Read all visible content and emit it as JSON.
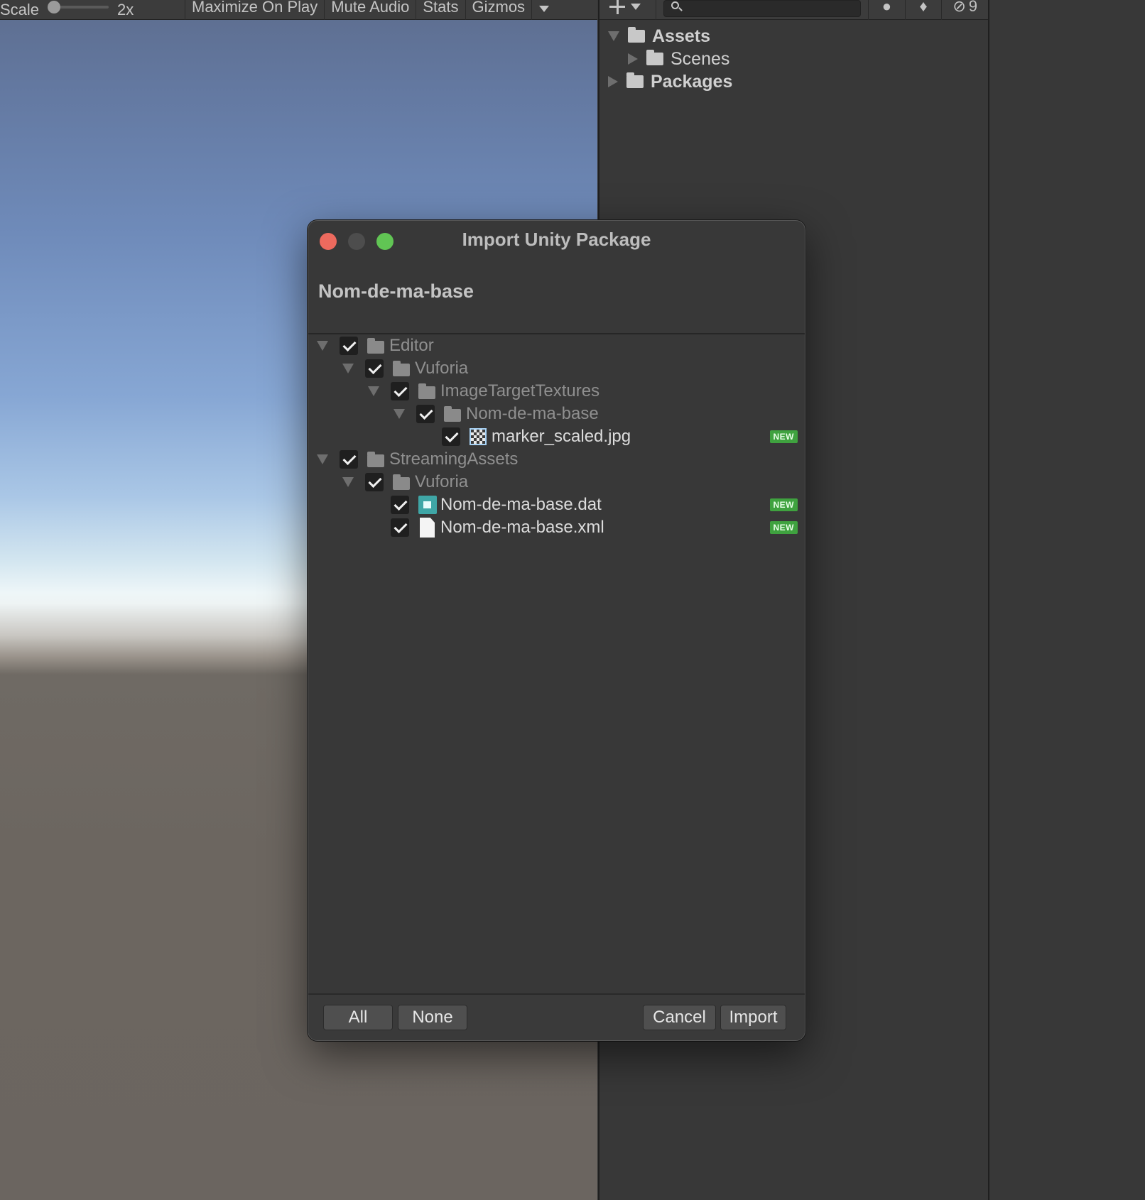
{
  "game_toolbar": {
    "scale_label": "Scale",
    "scale_value": "2x",
    "maximize_label": "Maximize On Play",
    "mute_label": "Mute Audio",
    "stats_label": "Stats",
    "gizmos_label": "Gizmos"
  },
  "project_panel": {
    "hidden_count": "9",
    "tree": [
      {
        "label": "Assets",
        "expanded": true
      },
      {
        "label": "Scenes",
        "expanded": false
      },
      {
        "label": "Packages",
        "expanded": false
      }
    ]
  },
  "dialog": {
    "title": "Import Unity Package",
    "package_name": "Nom-de-ma-base",
    "items": [
      {
        "label": "Editor",
        "checked": true
      },
      {
        "label": "Vuforia",
        "checked": true
      },
      {
        "label": "ImageTargetTextures",
        "checked": true
      },
      {
        "label": "Nom-de-ma-base",
        "checked": true
      },
      {
        "label": "marker_scaled.jpg",
        "checked": true,
        "badge": "NEW"
      },
      {
        "label": "StreamingAssets",
        "checked": true
      },
      {
        "label": "Vuforia",
        "checked": true
      },
      {
        "label": "Nom-de-ma-base.dat",
        "checked": true,
        "badge": "NEW"
      },
      {
        "label": "Nom-de-ma-base.xml",
        "checked": true,
        "badge": "NEW"
      }
    ],
    "buttons": {
      "all": "All",
      "none": "None",
      "cancel": "Cancel",
      "import": "Import"
    }
  },
  "colors": {
    "badge_new": "#3fa23f",
    "close_button": "#ed6a5e",
    "maximize_button": "#61c554",
    "panel_background": "#383838"
  }
}
